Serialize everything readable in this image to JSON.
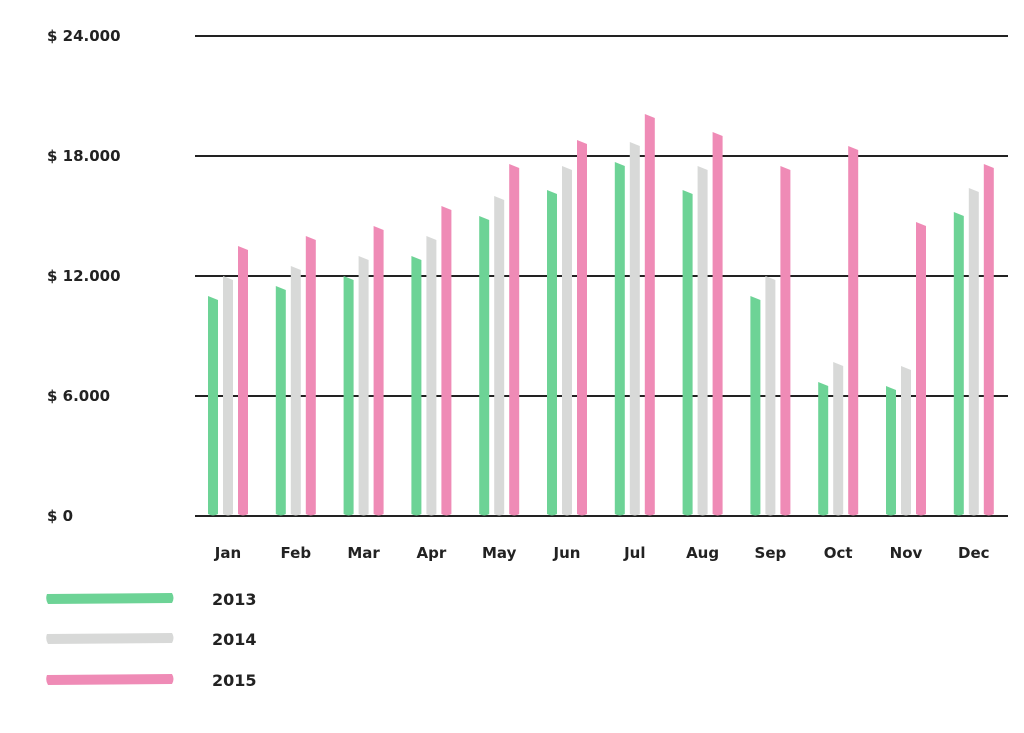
{
  "chart_data": {
    "type": "bar",
    "title": "",
    "xlabel": "",
    "ylabel": "",
    "ylim": [
      0,
      24000
    ],
    "yticks": [
      0,
      6000,
      12000,
      18000,
      24000
    ],
    "ytick_labels": [
      "$ 0",
      "$ 6.000",
      "$ 12.000",
      "$ 18.000",
      "$ 24.000"
    ],
    "grid": true,
    "legend_position": "bottom-left",
    "categories": [
      "Jan",
      "Feb",
      "Mar",
      "Apr",
      "May",
      "Jun",
      "Jul",
      "Aug",
      "Sep",
      "Oct",
      "Nov",
      "Dec"
    ],
    "series": [
      {
        "name": "2013",
        "color": "#6dd396",
        "values": [
          11000,
          11500,
          12000,
          13000,
          15000,
          16300,
          17700,
          16300,
          11000,
          6700,
          6500,
          15200
        ]
      },
      {
        "name": "2014",
        "color": "#d8d9d8",
        "values": [
          12000,
          12500,
          13000,
          14000,
          16000,
          17500,
          18700,
          17500,
          12000,
          7700,
          7500,
          16400
        ]
      },
      {
        "name": "2015",
        "color": "#ef8bb6",
        "values": [
          13500,
          14000,
          14500,
          15500,
          17600,
          18800,
          20100,
          19200,
          17500,
          18500,
          14700,
          17600
        ]
      }
    ]
  }
}
